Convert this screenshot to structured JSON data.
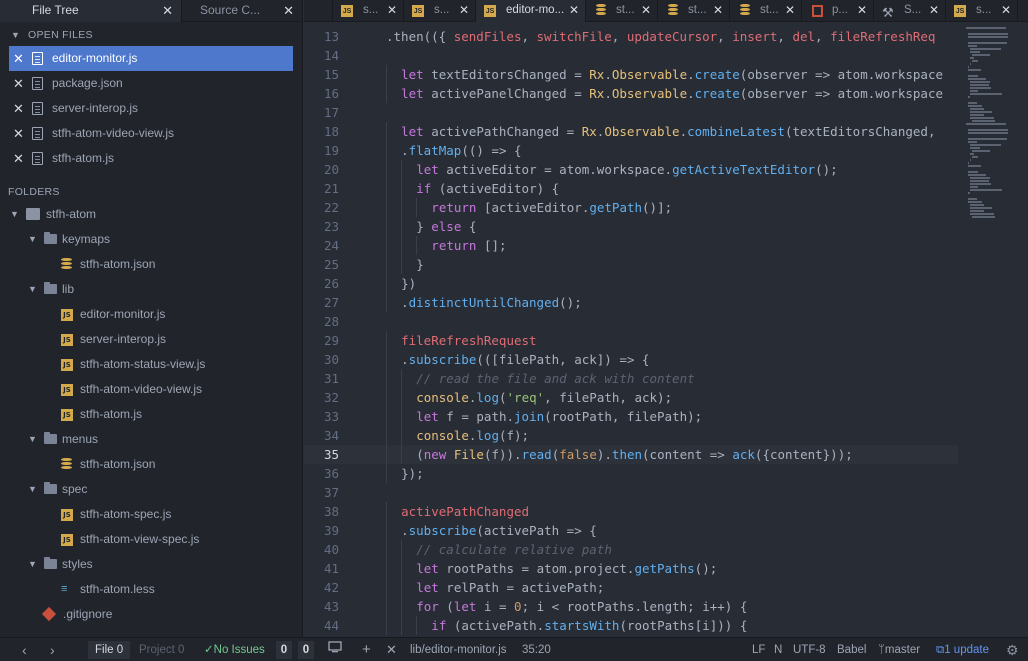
{
  "left_tabs": [
    {
      "label": "File Tree",
      "active": true
    },
    {
      "label": "Source C...",
      "active": false
    }
  ],
  "open_files": {
    "heading": "OPEN FILES",
    "items": [
      {
        "label": "editor-monitor.js",
        "active": true
      },
      {
        "label": "package.json",
        "active": false
      },
      {
        "label": "server-interop.js",
        "active": false
      },
      {
        "label": "stfh-atom-video-view.js",
        "active": false
      },
      {
        "label": "stfh-atom.js",
        "active": false
      }
    ]
  },
  "folders": {
    "heading": "FOLDERS",
    "tree": [
      {
        "label": "stfh-atom",
        "kind": "repo",
        "depth": 0,
        "chev": "down"
      },
      {
        "label": "keymaps",
        "kind": "folder",
        "depth": 1,
        "chev": "down"
      },
      {
        "label": "stfh-atom.json",
        "kind": "json",
        "depth": 2
      },
      {
        "label": "lib",
        "kind": "folder",
        "depth": 1,
        "chev": "down"
      },
      {
        "label": "editor-monitor.js",
        "kind": "js",
        "depth": 2
      },
      {
        "label": "server-interop.js",
        "kind": "js",
        "depth": 2
      },
      {
        "label": "stfh-atom-status-view.js",
        "kind": "js",
        "depth": 2
      },
      {
        "label": "stfh-atom-video-view.js",
        "kind": "js",
        "depth": 2
      },
      {
        "label": "stfh-atom.js",
        "kind": "js",
        "depth": 2
      },
      {
        "label": "menus",
        "kind": "folder",
        "depth": 1,
        "chev": "down"
      },
      {
        "label": "stfh-atom.json",
        "kind": "json",
        "depth": 2
      },
      {
        "label": "spec",
        "kind": "folder",
        "depth": 1,
        "chev": "down"
      },
      {
        "label": "stfh-atom-spec.js",
        "kind": "js",
        "depth": 2
      },
      {
        "label": "stfh-atom-view-spec.js",
        "kind": "js",
        "depth": 2
      },
      {
        "label": "styles",
        "kind": "folder",
        "depth": 1,
        "chev": "down"
      },
      {
        "label": "stfh-atom.less",
        "kind": "less",
        "depth": 2
      },
      {
        "label": ".gitignore",
        "kind": "git",
        "depth": 1
      }
    ]
  },
  "editor_tabs": [
    {
      "label": "s...",
      "icon": "js",
      "active": false
    },
    {
      "label": "s...",
      "icon": "js",
      "active": false
    },
    {
      "label": "editor-mo...",
      "icon": "js",
      "active": true
    },
    {
      "label": "st...",
      "icon": "db",
      "active": false
    },
    {
      "label": "st...",
      "icon": "db",
      "active": false
    },
    {
      "label": "st...",
      "icon": "db",
      "active": false
    },
    {
      "label": "p...",
      "icon": "book",
      "active": false
    },
    {
      "label": "S...",
      "icon": "tools",
      "active": false
    },
    {
      "label": "s...",
      "icon": "js",
      "active": false
    }
  ],
  "editor": {
    "current_line": 35,
    "lines": [
      {
        "n": "13",
        "i": 1,
        "t": [
          [
            ".then(({ ",
            ""
          ],
          [
            "sendFiles",
            "v"
          ],
          [
            ", ",
            ""
          ],
          [
            "switchFile",
            "v"
          ],
          [
            ", ",
            ""
          ],
          [
            "updateCursor",
            "v"
          ],
          [
            ", ",
            ""
          ],
          [
            "insert",
            "v"
          ],
          [
            ", ",
            ""
          ],
          [
            "del",
            "v"
          ],
          [
            ", ",
            ""
          ],
          [
            "fileRefreshReq",
            "v"
          ]
        ]
      },
      {
        "n": "14",
        "i": 0,
        "t": []
      },
      {
        "n": "15",
        "i": 2,
        "t": [
          [
            "let ",
            "k"
          ],
          [
            "textEditorsChanged = ",
            ""
          ],
          [
            "Rx",
            "t"
          ],
          [
            ".",
            ""
          ],
          [
            "Observable",
            "t"
          ],
          [
            ".",
            ""
          ],
          [
            "create",
            "f"
          ],
          [
            "(observer => atom.workspace",
            ""
          ]
        ]
      },
      {
        "n": "16",
        "i": 2,
        "t": [
          [
            "let ",
            "k"
          ],
          [
            "activePanelChanged = ",
            ""
          ],
          [
            "Rx",
            "t"
          ],
          [
            ".",
            ""
          ],
          [
            "Observable",
            "t"
          ],
          [
            ".",
            ""
          ],
          [
            "create",
            "f"
          ],
          [
            "(observer => atom.workspace",
            ""
          ]
        ]
      },
      {
        "n": "17",
        "i": 0,
        "t": []
      },
      {
        "n": "18",
        "i": 2,
        "t": [
          [
            "let ",
            "k"
          ],
          [
            "activePathChanged = ",
            ""
          ],
          [
            "Rx",
            "t"
          ],
          [
            ".",
            ""
          ],
          [
            "Observable",
            "t"
          ],
          [
            ".",
            ""
          ],
          [
            "combineLatest",
            "f"
          ],
          [
            "(textEditorsChanged,",
            ""
          ]
        ]
      },
      {
        "n": "19",
        "i": 2,
        "t": [
          [
            ".",
            ""
          ],
          [
            "flatMap",
            "f"
          ],
          [
            "(() => {",
            ""
          ]
        ]
      },
      {
        "n": "20",
        "i": 3,
        "t": [
          [
            "let ",
            "k"
          ],
          [
            "activeEditor = atom.workspace.",
            ""
          ],
          [
            "getActiveTextEditor",
            "f"
          ],
          [
            "();",
            ""
          ]
        ]
      },
      {
        "n": "21",
        "i": 3,
        "t": [
          [
            "if ",
            "k"
          ],
          [
            "(activeEditor) {",
            ""
          ]
        ]
      },
      {
        "n": "22",
        "i": 4,
        "t": [
          [
            "return ",
            "k"
          ],
          [
            "[activeEditor.",
            ""
          ],
          [
            "getPath",
            "f"
          ],
          [
            "()];",
            ""
          ]
        ]
      },
      {
        "n": "23",
        "i": 3,
        "t": [
          [
            "} ",
            ""
          ],
          [
            "else ",
            "k"
          ],
          [
            "{",
            ""
          ]
        ]
      },
      {
        "n": "24",
        "i": 4,
        "t": [
          [
            "return ",
            "k"
          ],
          [
            "[];",
            ""
          ]
        ]
      },
      {
        "n": "25",
        "i": 3,
        "t": [
          [
            "}",
            ""
          ]
        ]
      },
      {
        "n": "26",
        "i": 2,
        "t": [
          [
            "})",
            ""
          ]
        ]
      },
      {
        "n": "27",
        "i": 2,
        "t": [
          [
            ".",
            ""
          ],
          [
            "distinctUntilChanged",
            "f"
          ],
          [
            "();",
            ""
          ]
        ]
      },
      {
        "n": "28",
        "i": 0,
        "t": []
      },
      {
        "n": "29",
        "i": 2,
        "t": [
          [
            "fileRefreshRequest",
            "v"
          ]
        ]
      },
      {
        "n": "30",
        "i": 2,
        "t": [
          [
            ".",
            ""
          ],
          [
            "subscribe",
            "f"
          ],
          [
            "(([filePath, ack]) => {",
            ""
          ]
        ]
      },
      {
        "n": "31",
        "i": 3,
        "t": [
          [
            "// read the file and ack with content",
            "c"
          ]
        ]
      },
      {
        "n": "32",
        "i": 3,
        "t": [
          [
            "console",
            "t"
          ],
          [
            ".",
            ""
          ],
          [
            "log",
            "f"
          ],
          [
            "(",
            ""
          ],
          [
            "'req'",
            "s"
          ],
          [
            ", filePath, ack);",
            ""
          ]
        ]
      },
      {
        "n": "33",
        "i": 3,
        "t": [
          [
            "let ",
            "k"
          ],
          [
            "f = path.",
            ""
          ],
          [
            "join",
            "f"
          ],
          [
            "(rootPath, filePath);",
            ""
          ]
        ]
      },
      {
        "n": "34",
        "i": 3,
        "t": [
          [
            "console",
            "t"
          ],
          [
            ".",
            ""
          ],
          [
            "log",
            "f"
          ],
          [
            "(f);",
            ""
          ]
        ]
      },
      {
        "n": "35",
        "i": 3,
        "t": [
          [
            "(",
            ""
          ],
          [
            "new ",
            "k"
          ],
          [
            "File",
            "t"
          ],
          [
            "(f)).",
            ""
          ],
          [
            "read",
            "f"
          ],
          [
            "(",
            ""
          ],
          [
            "false",
            "n"
          ],
          [
            ").",
            ""
          ],
          [
            "then",
            "f"
          ],
          [
            "(content => ",
            ""
          ],
          [
            "ack",
            "f"
          ],
          [
            "({content}));",
            ""
          ]
        ]
      },
      {
        "n": "36",
        "i": 2,
        "t": [
          [
            "});",
            ""
          ]
        ]
      },
      {
        "n": "37",
        "i": 0,
        "t": []
      },
      {
        "n": "38",
        "i": 2,
        "t": [
          [
            "activePathChanged",
            "v"
          ]
        ]
      },
      {
        "n": "39",
        "i": 2,
        "t": [
          [
            ".",
            ""
          ],
          [
            "subscribe",
            "f"
          ],
          [
            "(activePath => {",
            ""
          ]
        ]
      },
      {
        "n": "40",
        "i": 3,
        "t": [
          [
            "// calculate relative path",
            "c"
          ]
        ]
      },
      {
        "n": "41",
        "i": 3,
        "t": [
          [
            "let ",
            "k"
          ],
          [
            "rootPaths = atom.project.",
            ""
          ],
          [
            "getPaths",
            "f"
          ],
          [
            "();",
            ""
          ]
        ]
      },
      {
        "n": "42",
        "i": 3,
        "t": [
          [
            "let ",
            "k"
          ],
          [
            "relPath = activePath;",
            ""
          ]
        ]
      },
      {
        "n": "43",
        "i": 3,
        "t": [
          [
            "for ",
            "k"
          ],
          [
            "(",
            ""
          ],
          [
            "let ",
            "k"
          ],
          [
            "i = ",
            ""
          ],
          [
            "0",
            "n"
          ],
          [
            "; i < rootPaths.length; i++) {",
            ""
          ]
        ]
      },
      {
        "n": "44",
        "i": 4,
        "t": [
          [
            "if ",
            "k"
          ],
          [
            "(activePath.",
            ""
          ],
          [
            "startsWith",
            "f"
          ],
          [
            "(rootPaths[i])) {",
            ""
          ]
        ]
      }
    ]
  },
  "status": {
    "file_tab": {
      "label": "File",
      "count": "0"
    },
    "project_tab": {
      "label": "Project",
      "count": "0"
    },
    "no_issues": "No Issues",
    "counts": [
      "0",
      "0"
    ],
    "path": "lib/editor-monitor.js",
    "cursor": "35:20",
    "line_ending": "LF",
    "n": "N",
    "encoding": "UTF-8",
    "grammar": "Babel",
    "branch": "master",
    "updates": "1 update"
  },
  "colors": {
    "selection": "#4d78cc",
    "status_green": "#73c990",
    "update_blue": "#6494ed"
  }
}
